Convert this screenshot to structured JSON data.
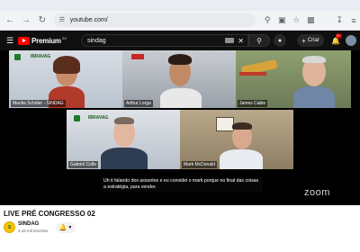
{
  "browser": {
    "url": "youtube.com/",
    "icons": [
      "back-icon",
      "forward-icon",
      "reload-icon",
      "site-info-icon",
      "search-page-icon",
      "cast-icon",
      "bookmark-star-icon",
      "extensions-icon",
      "downloads-icon",
      "tab-search-icon"
    ]
  },
  "youtube": {
    "brand": "Premium",
    "region": "BR",
    "search_value": "sindag",
    "create_label": "Criar",
    "notifications_badge": "9+"
  },
  "video": {
    "participants": [
      {
        "name": "Marilia Schüler - SINDAG"
      },
      {
        "name": "Arthur Lorga"
      },
      {
        "name": "James Cable"
      },
      {
        "name": "Gabriel Colle"
      },
      {
        "name": "Mark McDonald"
      }
    ],
    "org_logo_text": "IBRAVAG",
    "caption": "Uh it falando dos assuntos e eu convidei o mark porque no final das coisas a estratégia, para vender.",
    "zoom_watermark": "zoom"
  },
  "info": {
    "title": "LIVE PRÉ CONGRESSO 02",
    "channel_name": "SINDAG",
    "channel_subs": "3,44 mil inscritos",
    "channel_avatar_text": "S"
  },
  "colors": {
    "youtube_red": "#ff0000",
    "sindag_green": "#1f7a2a",
    "sindag_yellow": "#f5c300"
  }
}
